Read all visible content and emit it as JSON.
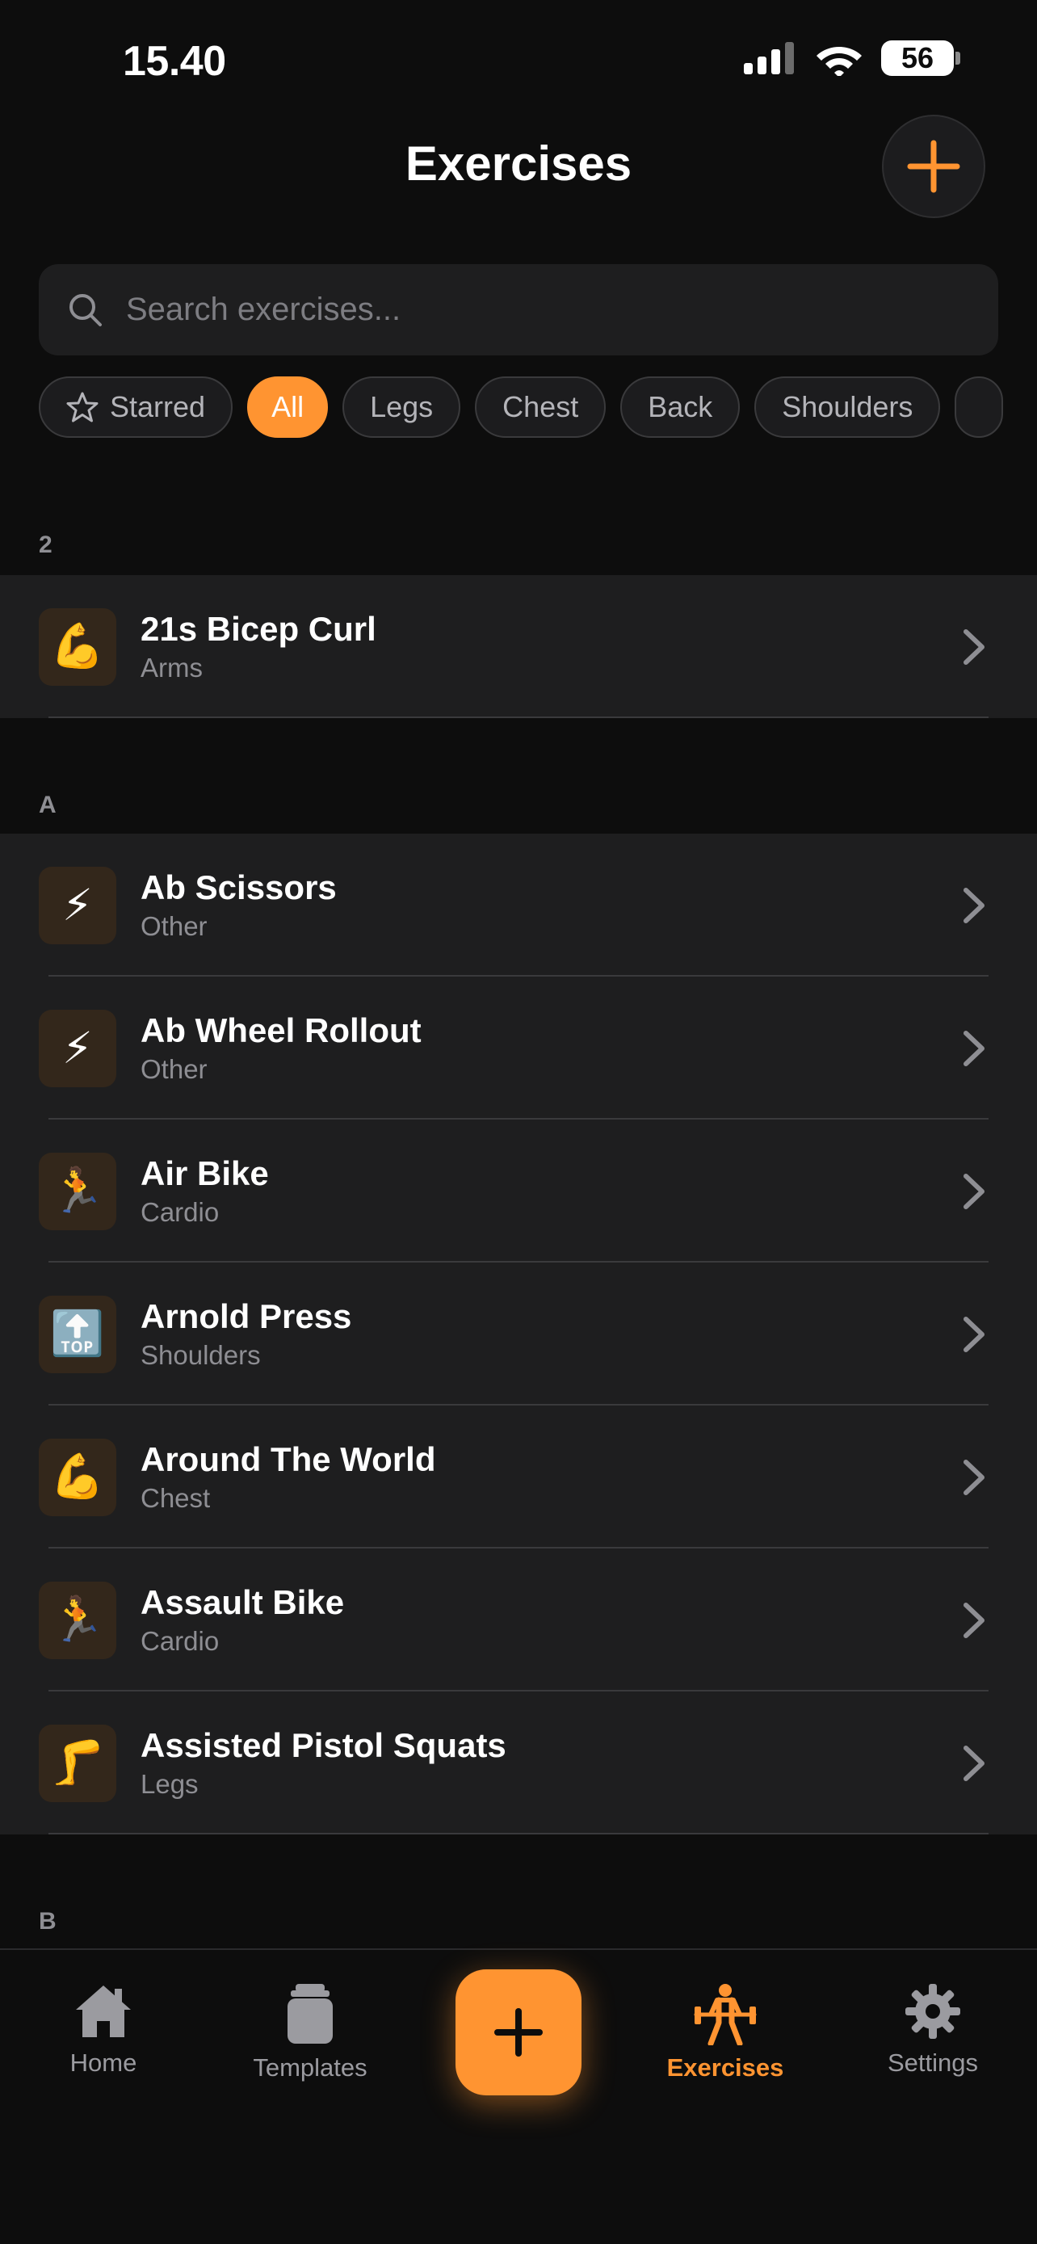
{
  "status_bar": {
    "time": "15.40",
    "battery": "56"
  },
  "header": {
    "title": "Exercises"
  },
  "search": {
    "placeholder": "Search exercises..."
  },
  "filters": [
    {
      "label": "Starred",
      "icon": "star-icon"
    },
    {
      "label": "All",
      "active": true
    },
    {
      "label": "Legs"
    },
    {
      "label": "Chest"
    },
    {
      "label": "Back"
    },
    {
      "label": "Shoulders"
    }
  ],
  "sections": [
    {
      "letter": "2",
      "items": [
        {
          "name": "21s Bicep Curl",
          "category": "Arms",
          "icon": "flexed-biceps-icon",
          "glyph": "💪"
        }
      ]
    },
    {
      "letter": "A",
      "items": [
        {
          "name": "Ab Scissors",
          "category": "Other",
          "icon": "lightning-icon",
          "glyph": "⚡"
        },
        {
          "name": "Ab Wheel Rollout",
          "category": "Other",
          "icon": "lightning-icon",
          "glyph": "⚡"
        },
        {
          "name": "Air Bike",
          "category": "Cardio",
          "icon": "runner-icon",
          "glyph": "🏃"
        },
        {
          "name": "Arnold Press",
          "category": "Shoulders",
          "icon": "top-arrow-icon",
          "glyph": "🔝"
        },
        {
          "name": "Around The World",
          "category": "Chest",
          "icon": "flexed-biceps-icon",
          "glyph": "💪"
        },
        {
          "name": "Assault Bike",
          "category": "Cardio",
          "icon": "runner-icon",
          "glyph": "🏃"
        },
        {
          "name": "Assisted Pistol Squats",
          "category": "Legs",
          "icon": "leg-icon",
          "glyph": "🦵"
        }
      ]
    },
    {
      "letter": "B",
      "items": []
    }
  ],
  "tab_bar": {
    "tabs": [
      {
        "label": "Home",
        "icon": "home-icon"
      },
      {
        "label": "Templates",
        "icon": "templates-icon"
      },
      {
        "label": "Exercises",
        "icon": "weightlifter-icon",
        "active": true
      },
      {
        "label": "Settings",
        "icon": "gear-icon"
      }
    ],
    "center_icon": "plus-icon"
  },
  "colors": {
    "accent": "#ff9431",
    "background": "#0d0d0d",
    "surface": "#1e1e1f",
    "secondary_text": "#8e8e93"
  }
}
